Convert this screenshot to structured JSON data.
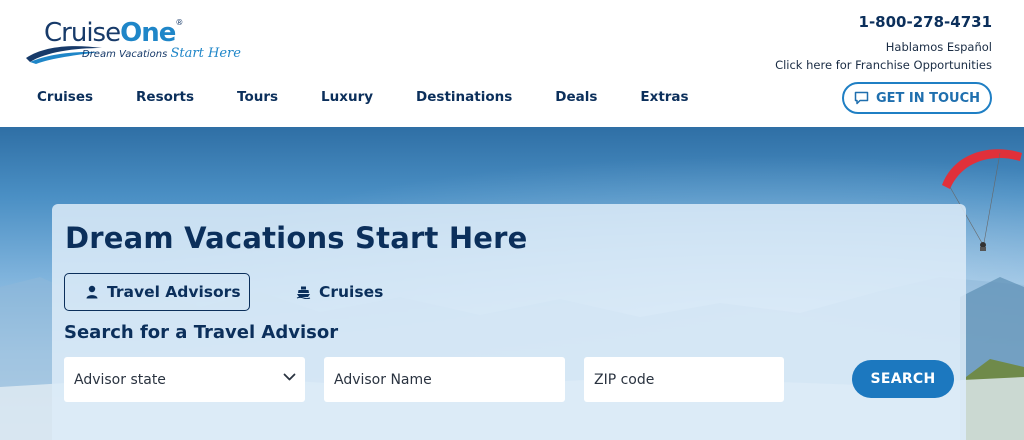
{
  "brand": {
    "name_part1": "Cruise",
    "name_part2": "One",
    "registered": "®",
    "tagline": "Dream Vacations",
    "tagline_script": "Start Here"
  },
  "contact": {
    "phone": "1-800-278-4731",
    "spanish": "Hablamos Español",
    "franchise": "Click here for Franchise Opportunities"
  },
  "nav": {
    "items": [
      "Cruises",
      "Resorts",
      "Tours",
      "Luxury",
      "Destinations",
      "Deals",
      "Extras"
    ]
  },
  "cta": {
    "label": "GET IN TOUCH",
    "icon": "chat-bubble-icon"
  },
  "hero": {
    "title": "Dream Vacations Start Here",
    "tabs": [
      {
        "label": "Travel Advisors",
        "icon": "person-icon",
        "selected": true
      },
      {
        "label": "Cruises",
        "icon": "ship-icon",
        "selected": false
      }
    ],
    "subheading": "Search for a Travel Advisor",
    "fields": {
      "state_placeholder": "Advisor state",
      "name_placeholder": "Advisor Name",
      "zip_placeholder": "ZIP code"
    },
    "search_label": "SEARCH"
  },
  "colors": {
    "navy": "#0b2f5b",
    "accent": "#1c78bf",
    "paraglider": "#e0303a"
  }
}
